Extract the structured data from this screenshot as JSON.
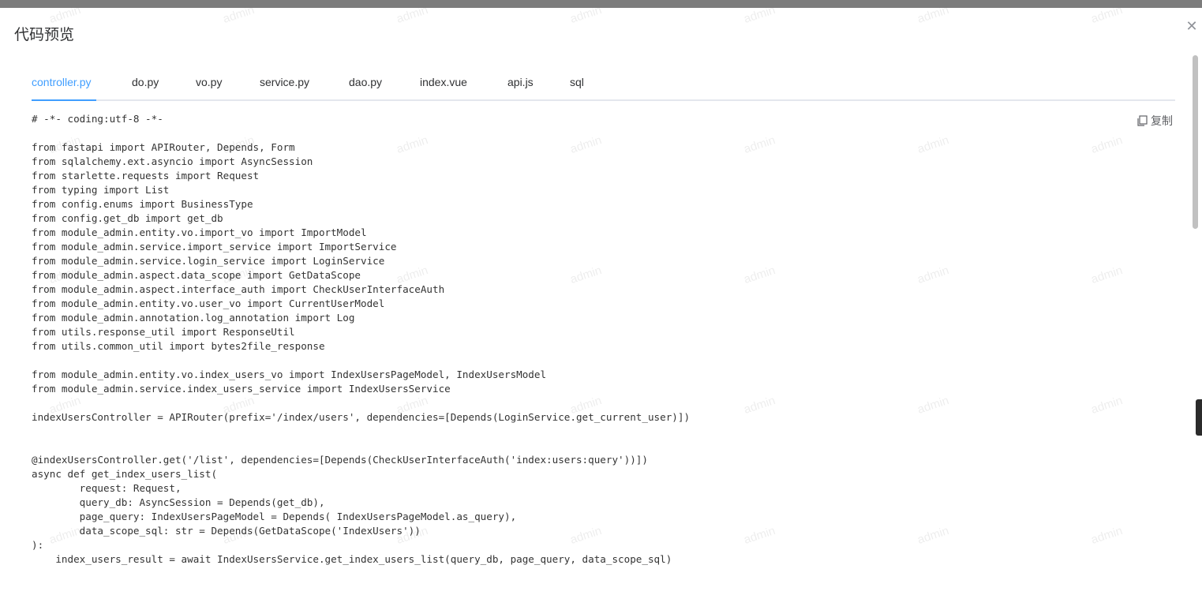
{
  "dialog": {
    "title": "代码预览",
    "close_icon": "close-icon"
  },
  "tabs": [
    {
      "label": "controller.py",
      "active": true
    },
    {
      "label": "do.py",
      "active": false
    },
    {
      "label": "vo.py",
      "active": false
    },
    {
      "label": "service.py",
      "active": false
    },
    {
      "label": "dao.py",
      "active": false
    },
    {
      "label": "index.vue",
      "active": false
    },
    {
      "label": "api.js",
      "active": false
    },
    {
      "label": "sql",
      "active": false
    }
  ],
  "copy": {
    "label": "复制",
    "icon": "copy-icon"
  },
  "watermark": "admin",
  "accent_color": "#409eff",
  "code_lines": [
    "# -*- coding:utf-8 -*-",
    "",
    "from fastapi import APIRouter, Depends, Form",
    "from sqlalchemy.ext.asyncio import AsyncSession",
    "from starlette.requests import Request",
    "from typing import List",
    "from config.enums import BusinessType",
    "from config.get_db import get_db",
    "from module_admin.entity.vo.import_vo import ImportModel",
    "from module_admin.service.import_service import ImportService",
    "from module_admin.service.login_service import LoginService",
    "from module_admin.aspect.data_scope import GetDataScope",
    "from module_admin.aspect.interface_auth import CheckUserInterfaceAuth",
    "from module_admin.entity.vo.user_vo import CurrentUserModel",
    "from module_admin.annotation.log_annotation import Log",
    "from utils.response_util import ResponseUtil",
    "from utils.common_util import bytes2file_response",
    "",
    "from module_admin.entity.vo.index_users_vo import IndexUsersPageModel, IndexUsersModel",
    "from module_admin.service.index_users_service import IndexUsersService",
    "",
    "indexUsersController = APIRouter(prefix='/index/users', dependencies=[Depends(LoginService.get_current_user)])",
    "",
    "",
    "@indexUsersController.get('/list', dependencies=[Depends(CheckUserInterfaceAuth('index:users:query'))])",
    "async def get_index_users_list(",
    "        request: Request,",
    "        query_db: AsyncSession = Depends(get_db),",
    "        page_query: IndexUsersPageModel = Depends( IndexUsersPageModel.as_query),",
    "        data_scope_sql: str = Depends(GetDataScope('IndexUsers'))",
    "):",
    "    index_users_result = await IndexUsersService.get_index_users_list(query_db, page_query, data_scope_sql)"
  ]
}
